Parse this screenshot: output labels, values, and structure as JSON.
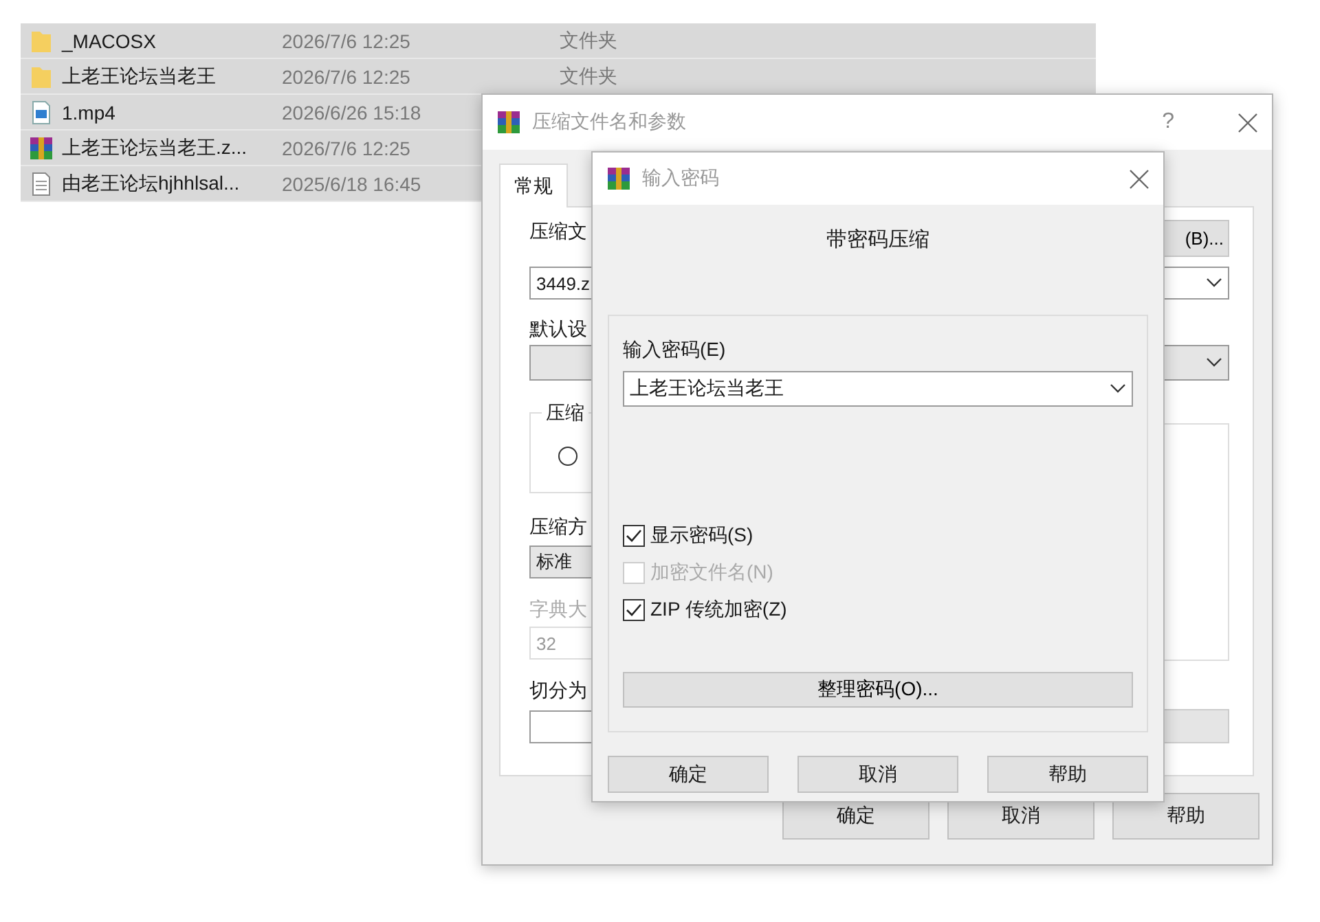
{
  "file_list": {
    "rows": [
      {
        "kind": "folder",
        "name": "_MACOSX",
        "modified": "2026/7/6 12:25",
        "type": "文件夹",
        "selected": true
      },
      {
        "kind": "folder",
        "name": "上老王论坛当老王",
        "modified": "2026/7/6 12:25",
        "type": "文件夹",
        "selected": true
      },
      {
        "kind": "video",
        "name": "1.mp4",
        "modified": "2026/6/26 15:18",
        "selected": true
      },
      {
        "kind": "archive",
        "name": "上老王论坛当老王.z...",
        "modified": "2026/7/6 12:25",
        "selected": true
      },
      {
        "kind": "text",
        "name": "由老王论坛hjhhlsal...",
        "modified": "2025/6/18 16:45",
        "selected": true
      }
    ]
  },
  "archive_dialog": {
    "title": "压缩文件名和参数",
    "help": "?",
    "tabs": [
      {
        "label": "常规",
        "selected": true
      }
    ],
    "name_label": "压缩文",
    "archive_name": "3449.z",
    "browse_button": "(B)...",
    "profile_label": "默认设",
    "format_group_label": "压缩",
    "format_radio": {
      "selected": false
    },
    "method_label": "压缩方",
    "method_value": "标准",
    "dict_label": "字典大",
    "dict_value": "32",
    "split_label": "切分为",
    "buttons": [
      "确定",
      "取消",
      "帮助"
    ]
  },
  "password_dialog": {
    "title": "输入密码",
    "heading": "带密码压缩",
    "password_label": "输入密码(E)",
    "password_value": "上老王论坛当老王",
    "options": [
      {
        "label": "显示密码(S)",
        "checked": true,
        "disabled": false
      },
      {
        "label": "加密文件名(N)",
        "checked": false,
        "disabled": true
      },
      {
        "label": "ZIP 传统加密(Z)",
        "checked": true,
        "disabled": false
      }
    ],
    "organize_button": "整理密码(O)...",
    "buttons": [
      "确定",
      "取消",
      "帮助"
    ]
  }
}
